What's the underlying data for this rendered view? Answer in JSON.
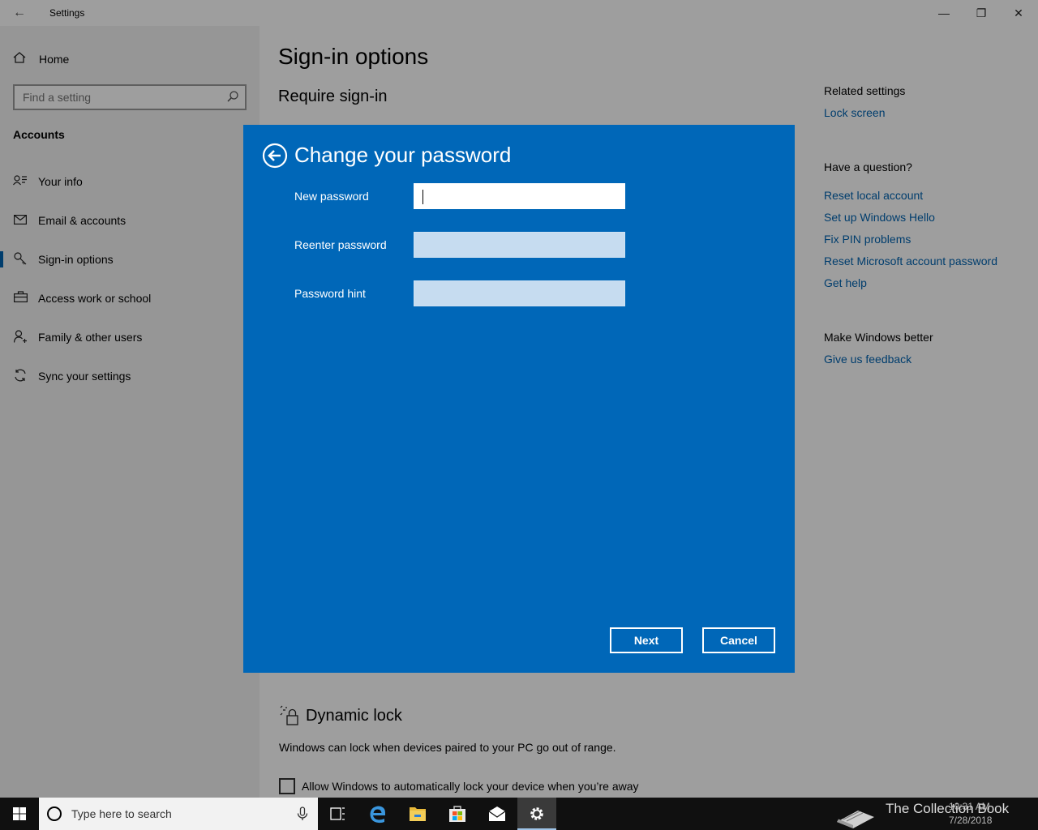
{
  "window": {
    "title": "Settings",
    "back_glyph": "←",
    "minimize_glyph": "—",
    "maximize_glyph": "❐",
    "close_glyph": "✕"
  },
  "sidebar": {
    "home_label": "Home",
    "search_placeholder": "Find a setting",
    "section_title": "Accounts",
    "items": [
      {
        "label": "Your info",
        "icon": "person-card-icon",
        "active": false
      },
      {
        "label": "Email & accounts",
        "icon": "mail-icon",
        "active": false
      },
      {
        "label": "Sign-in options",
        "icon": "key-icon",
        "active": true
      },
      {
        "label": "Access work or school",
        "icon": "briefcase-icon",
        "active": false
      },
      {
        "label": "Family & other users",
        "icon": "person-add-icon",
        "active": false
      },
      {
        "label": "Sync your settings",
        "icon": "sync-icon",
        "active": false
      }
    ]
  },
  "main": {
    "page_title": "Sign-in options",
    "require_heading": "Require sign-in",
    "dynamic_lock": {
      "heading": "Dynamic lock",
      "description": "Windows can lock when devices paired to your PC go out of range.",
      "checkbox_label": "Allow Windows to automatically lock your device when you’re away",
      "checked": false
    }
  },
  "related": {
    "related_heading": "Related settings",
    "lock_screen": "Lock screen",
    "question_heading": "Have a question?",
    "question_links": [
      "Reset local account",
      "Set up Windows Hello",
      "Fix PIN problems",
      "Reset Microsoft account password",
      "Get help"
    ],
    "better_heading": "Make Windows better",
    "feedback_link": "Give us feedback"
  },
  "dialog": {
    "title": "Change your password",
    "fields": {
      "new_password": {
        "label": "New password",
        "value": ""
      },
      "reenter_password": {
        "label": "Reenter password",
        "value": ""
      },
      "password_hint": {
        "label": "Password hint",
        "value": ""
      }
    },
    "next_label": "Next",
    "cancel_label": "Cancel"
  },
  "taskbar": {
    "search_placeholder": "Type here to search",
    "apps": [
      "task-view-icon",
      "edge-icon",
      "file-explorer-icon",
      "store-icon",
      "mail-icon",
      "settings-icon"
    ],
    "active_app": "settings-icon",
    "watermark": "The Collection Book",
    "time": "10:31 AM",
    "date": "7/28/2018"
  },
  "colors": {
    "accent": "#0067b8",
    "link": "#0063b1",
    "taskbar": "#101010"
  }
}
